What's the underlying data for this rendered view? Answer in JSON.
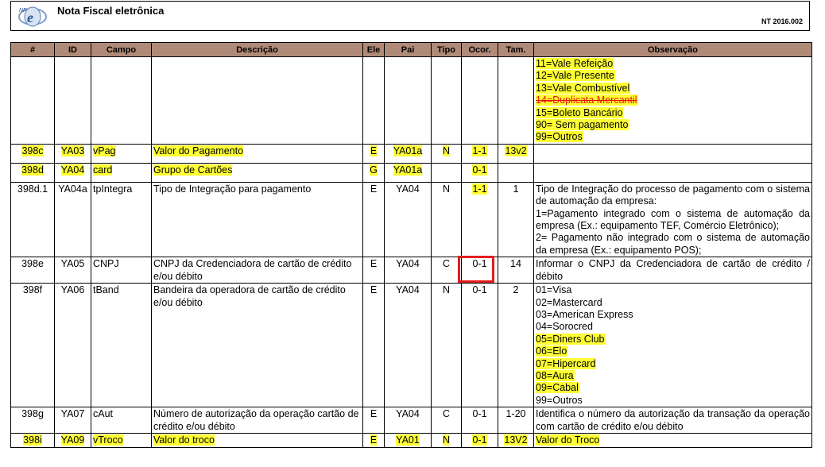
{
  "header": {
    "title": "Nota Fiscal eletrônica",
    "code": "NT 2016.002"
  },
  "columns": [
    "#",
    "ID",
    "Campo",
    "Descrição",
    "Ele",
    "Pai",
    "Tipo",
    "Ocor.",
    "Tam.",
    "Observação"
  ],
  "first_row": {
    "observacao": [
      {
        "text": "11=Vale Refeição",
        "style": "hl"
      },
      {
        "text": "12=Vale Presente",
        "style": "hl"
      },
      {
        "text": "13=Vale Combustível",
        "style": "hl"
      },
      {
        "text": "14=Duplicata Mercantil",
        "style": "strike"
      },
      {
        "text": "15=Boleto Bancário",
        "style": "hl"
      },
      {
        "text": "90= Sem pagamento",
        "style": "hl"
      },
      {
        "text": "99=Outros",
        "style": "hl"
      }
    ]
  },
  "rows": [
    {
      "num": "398c",
      "id": "YA03",
      "campo": "vPag",
      "descricao": "Valor do Pagamento",
      "ele": "E",
      "pai": "YA01a",
      "tipo": "N",
      "ocor": "1-1",
      "tam": "13v2",
      "observacao": "",
      "highlight": true
    },
    {
      "num": "398d",
      "id": "YA04",
      "campo": "card",
      "descricao": "Grupo de Cartões",
      "ele": "G",
      "pai": "YA01a",
      "tipo": "",
      "ocor": "0-1",
      "tam": "",
      "observacao": "",
      "highlight": true
    },
    {
      "num": "398d.1",
      "id": "YA04a",
      "campo": "tpIntegra",
      "descricao": "Tipo de Integração para pagamento",
      "ele": "E",
      "pai": "YA04",
      "tipo": "N",
      "ocor": "1-1",
      "tam": "1",
      "observacao": "Tipo de Integração do processo de pagamento com o sistema de automação da empresa:\n1=Pagamento integrado com o sistema de automação da empresa (Ex.: equipamento TEF, Comércio Eletrônico);\n2= Pagamento não integrado com o sistema de automação da empresa (Ex.: equipamento POS);",
      "highlight": false,
      "ocor_hl": true
    },
    {
      "num": "398e",
      "id": "YA05",
      "campo": "CNPJ",
      "descricao": "CNPJ da Credenciadora de cartão de crédito e/ou débito",
      "ele": "E",
      "pai": "YA04",
      "tipo": "C",
      "ocor": "0-1",
      "tam": "14",
      "observacao": "Informar o CNPJ da Credenciadora de cartão de crédito / débito",
      "highlight": false
    },
    {
      "num": "398f",
      "id": "YA06",
      "campo": "tBand",
      "descricao": "Bandeira da operadora de cartão de crédito e/ou débito",
      "ele": "E",
      "pai": "YA04",
      "tipo": "N",
      "ocor": "0-1",
      "tam": "2",
      "observacao": "",
      "highlight": false
    },
    {
      "num": "398g",
      "id": "YA07",
      "campo": "cAut",
      "descricao": "Número de autorização da operação cartão de crédito e/ou débito",
      "ele": "E",
      "pai": "YA04",
      "tipo": "C",
      "ocor": "0-1",
      "tam": "1-20",
      "observacao": "Identifica o número da autorização da transação da operação com cartão de crédito e/ou débito",
      "highlight": false
    },
    {
      "num": "398i",
      "id": "YA09",
      "campo": "vTroco",
      "descricao": "Valor do troco",
      "ele": "E",
      "pai": "YA01",
      "tipo": "N",
      "ocor": "0-1",
      "tam": "13V2",
      "observacao": "Valor do Troco",
      "highlight": true
    }
  ],
  "bandeiras": [
    {
      "text": "01=Visa",
      "style": ""
    },
    {
      "text": "02=Mastercard",
      "style": ""
    },
    {
      "text": "03=American Express",
      "style": ""
    },
    {
      "text": "04=Sorocred",
      "style": ""
    },
    {
      "text": "05=Diners Club",
      "style": "hl"
    },
    {
      "text": "06=Elo",
      "style": "hl"
    },
    {
      "text": "07=Hipercard",
      "style": "hl"
    },
    {
      "text": "08=Aura",
      "style": "hl"
    },
    {
      "text": "09=Cabal",
      "style": "hl"
    },
    {
      "text": "99=Outros",
      "style": ""
    }
  ],
  "colors": {
    "header_bg": "#b08a78",
    "highlight": "#ffff33",
    "strike": "#e81010",
    "box": "#e51c1c"
  }
}
